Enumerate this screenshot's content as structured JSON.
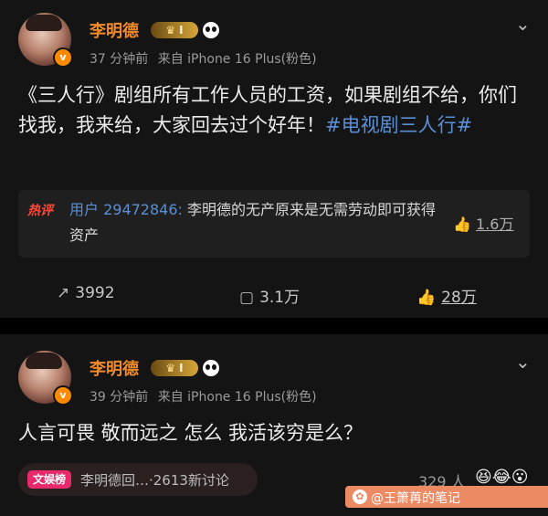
{
  "post1": {
    "author": "李明德",
    "vip_level": "I",
    "vip_icon": "crown-icon",
    "time": "37 分钟前",
    "source": "来自 iPhone 16 Plus(粉色)",
    "content_main": "《三人行》剧组所有工作人员的工资，如果剧组不给，你们找我，我来给，大家回去过个好年！",
    "content_tag": "#电视剧三人行#",
    "hot_comment": {
      "label": "热评",
      "user": "用户 29472846:",
      "text": " 李明德的无产原来是无需劳动即可获得资产",
      "likes": "1.6万"
    },
    "reposts": "3992",
    "comments": "3.1万",
    "likes": "28万"
  },
  "post2": {
    "author": "李明德",
    "vip_level": "I",
    "time": "39 分钟前",
    "source": "来自 iPhone 16 Plus(粉色)",
    "content": "人言可畏 敬而远之  怎么 我活该穷是么？",
    "chip_label": "文娱榜",
    "chip_text": "李明德回…·2613新讨论",
    "likes_partial": "329 人",
    "emojis": "😆😂😮"
  },
  "watermark": "@王箫苒的笔记",
  "colors": {
    "name": "#f08a2a",
    "tag": "#5a8fd6",
    "hot_label": "#ff4a3a",
    "chip_badge": "#e8296b"
  }
}
